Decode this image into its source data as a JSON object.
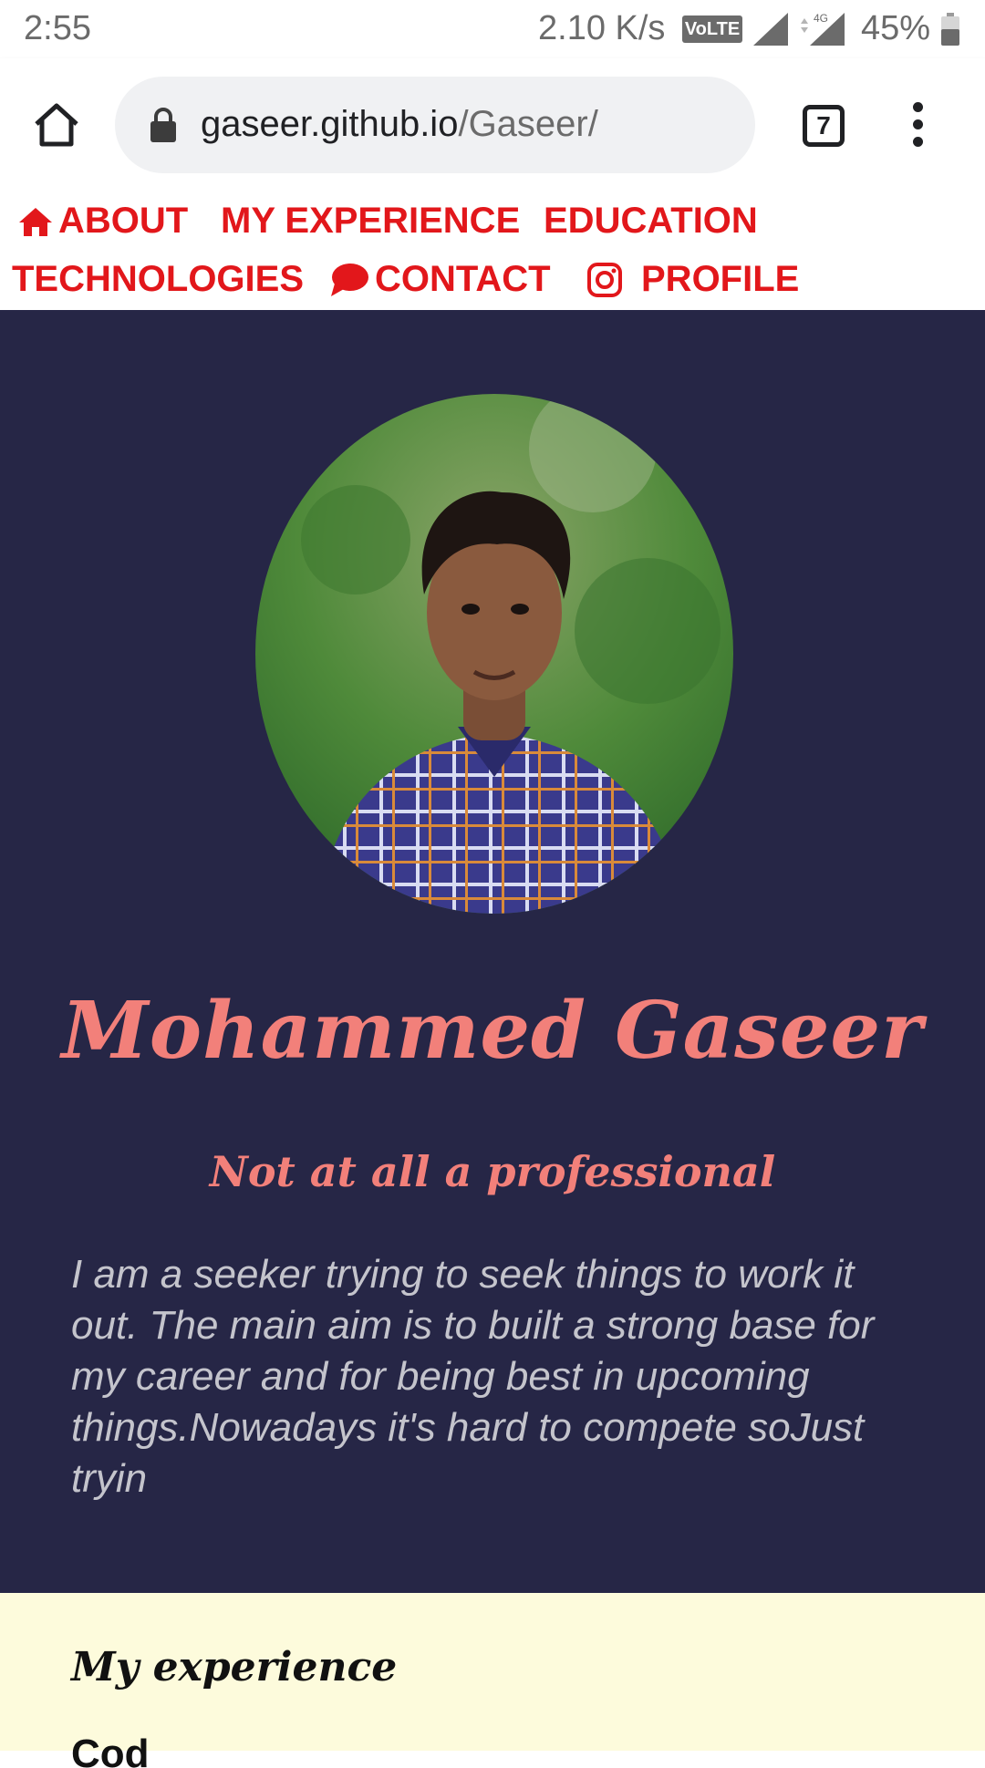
{
  "status_bar": {
    "time": "2:55",
    "speed": "2.10 K/s",
    "volte": "VoLTE",
    "network": "4G",
    "battery": "45%"
  },
  "browser": {
    "url_host": "gaseer.github.io",
    "url_path": "/Gaseer/",
    "tab_count": "7"
  },
  "nav": {
    "about": "ABOUT",
    "experience": "MY EXPERIENCE",
    "education": "EDUCATION",
    "technologies": "TECHNOLOGIES",
    "contact": "CONTACT",
    "profile": "PROFILE"
  },
  "hero": {
    "name": "Mohammed Gaseer",
    "tagline": "Not at all a professional",
    "bio": "I am a seeker trying to seek things to work it out. The main aim is to built a strong base for my career and for being best in upcoming things.Nowadays it's hard to compete soJust tryin"
  },
  "experience": {
    "heading": "My experience",
    "first_item_partial": "Cod"
  },
  "colors": {
    "nav_red": "#e2171b",
    "hero_bg": "#262646",
    "accent_salmon": "#f2807a",
    "bio_text": "#c4c4cc",
    "experience_bg": "#fdfbdc"
  },
  "icons": {
    "home": "home-icon",
    "lock": "lock-icon",
    "menu": "more-vert-icon",
    "about": "home-icon",
    "contact": "chat-bubble-icon",
    "profile": "instagram-icon"
  }
}
